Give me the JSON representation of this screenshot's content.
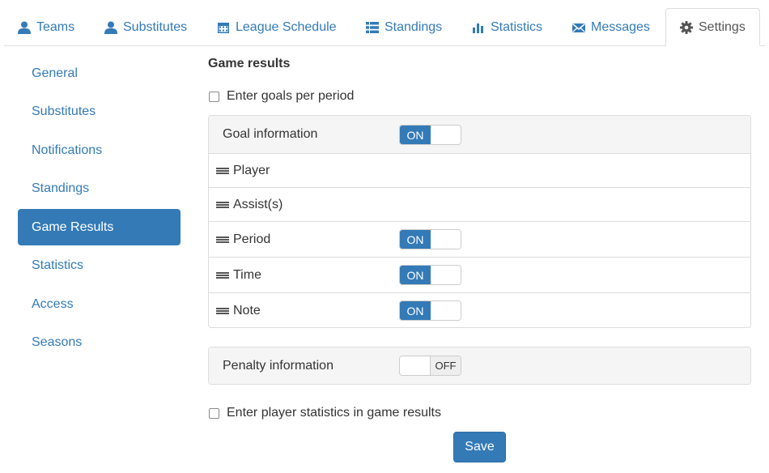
{
  "tabs": [
    {
      "label": "Teams",
      "icon": "user-icon"
    },
    {
      "label": "Substitutes",
      "icon": "user-icon"
    },
    {
      "label": "League Schedule",
      "icon": "calendar-icon"
    },
    {
      "label": "Standings",
      "icon": "list-icon"
    },
    {
      "label": "Statistics",
      "icon": "bar-chart-icon"
    },
    {
      "label": "Messages",
      "icon": "envelope-icon"
    },
    {
      "label": "Settings",
      "icon": "gear-icon",
      "active": true
    }
  ],
  "sidebar": {
    "items": [
      {
        "label": "General"
      },
      {
        "label": "Substitutes"
      },
      {
        "label": "Notifications"
      },
      {
        "label": "Standings"
      },
      {
        "label": "Game Results",
        "active": true
      },
      {
        "label": "Statistics"
      },
      {
        "label": "Access"
      },
      {
        "label": "Seasons"
      }
    ]
  },
  "main": {
    "title": "Game results",
    "goals_per_period": {
      "label": "Enter goals per period",
      "checked": false
    },
    "goal_panel": {
      "header": "Goal information",
      "header_toggle": "ON",
      "rows": [
        {
          "label": "Player"
        },
        {
          "label": "Assist(s)"
        },
        {
          "label": "Period",
          "toggle": "ON"
        },
        {
          "label": "Time",
          "toggle": "ON"
        },
        {
          "label": "Note",
          "toggle": "ON"
        }
      ]
    },
    "penalty_panel": {
      "header": "Penalty information",
      "toggle": "OFF"
    },
    "player_stats": {
      "label": "Enter player statistics in game results",
      "checked": false
    },
    "save_label": "Save"
  },
  "colors": {
    "accent": "#337ab7",
    "border": "#dddddd",
    "panel_bg": "#f5f5f5",
    "text": "#333333"
  }
}
